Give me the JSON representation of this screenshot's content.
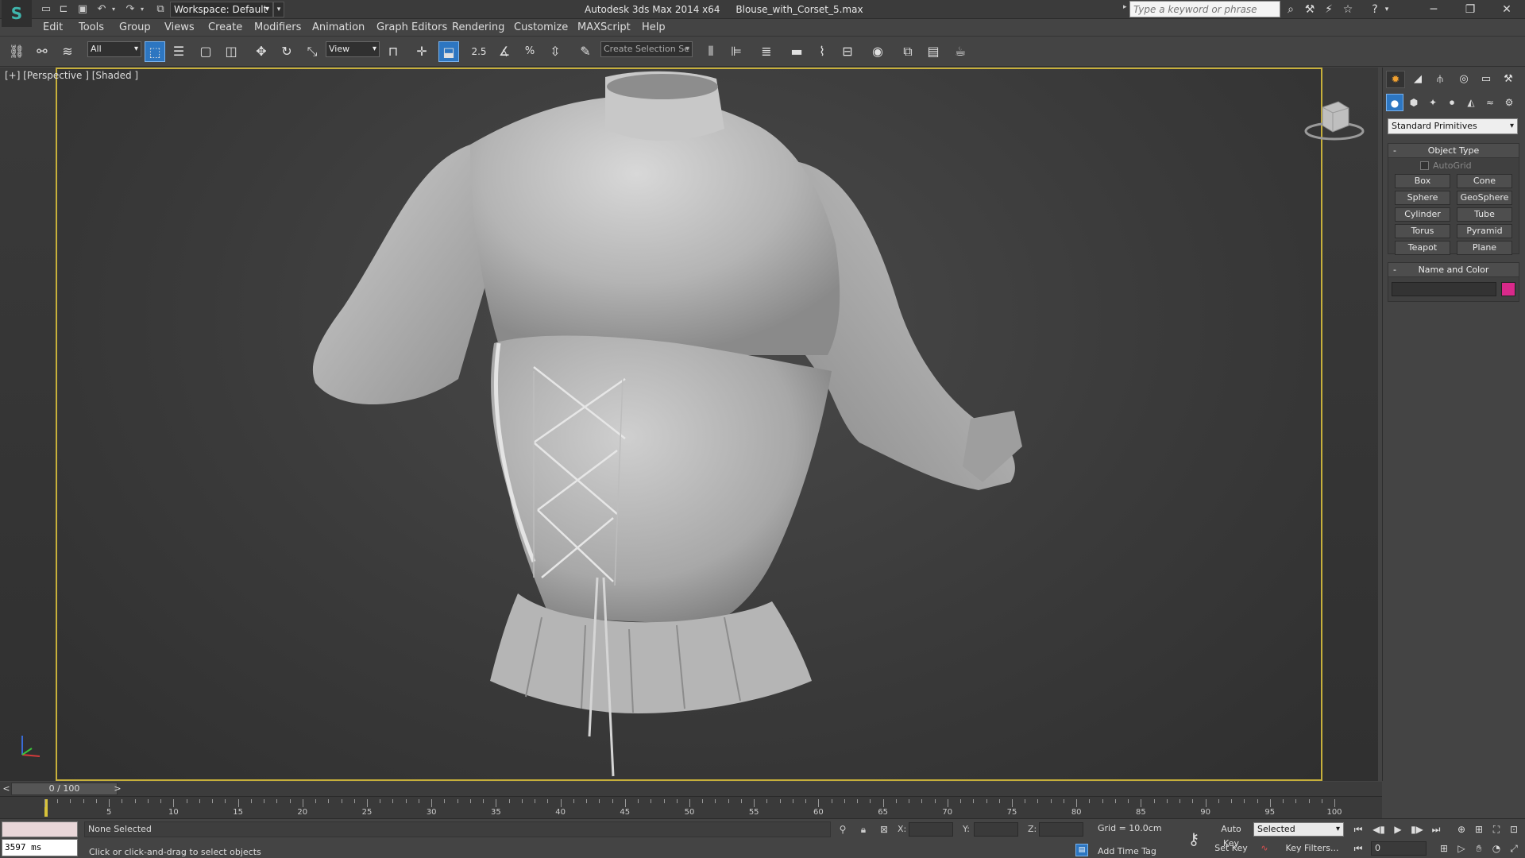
{
  "window": {
    "app_title": "Autodesk 3ds Max  2014 x64",
    "file_name": "Blouse_with_Corset_5.max",
    "workspace": "Workspace: Default",
    "search_placeholder": "Type a keyword or phrase"
  },
  "menu": [
    "Edit",
    "Tools",
    "Group",
    "Views",
    "Create",
    "Modifiers",
    "Animation",
    "Graph Editors",
    "Rendering",
    "Customize",
    "MAXScript",
    "Help"
  ],
  "toolbar": {
    "selection_filter": "All",
    "ref_coord": "View",
    "snap_angle": "2.5",
    "named_selection": "Create Selection Se"
  },
  "viewport": {
    "label": "[+] [Perspective ] [Shaded ]"
  },
  "command_panel": {
    "category": "Standard Primitives",
    "object_type_title": "Object Type",
    "autogrid": "AutoGrid",
    "primitives": [
      "Box",
      "Cone",
      "Sphere",
      "GeoSphere",
      "Cylinder",
      "Tube",
      "Torus",
      "Pyramid",
      "Teapot",
      "Plane"
    ],
    "name_color_title": "Name and Color",
    "object_color": "#d9298a"
  },
  "timeline": {
    "position": "0 / 100",
    "ticks": [
      "5",
      "10",
      "15",
      "20",
      "25",
      "30",
      "35",
      "40",
      "45",
      "50",
      "55",
      "60",
      "65",
      "70",
      "75",
      "80",
      "85",
      "90",
      "95",
      "100"
    ]
  },
  "status": {
    "maxscript_output": "3597 ms",
    "selection": "None Selected",
    "prompt": "Click or click-and-drag to select objects",
    "x_label": "X:",
    "y_label": "Y:",
    "z_label": "Z:",
    "grid": "Grid = 10.0cm",
    "add_time_tag": "Add Time Tag",
    "auto_key": "Auto Key",
    "set_key": "Set Key",
    "key_mode": "Selected",
    "key_filters": "Key Filters...",
    "current_frame": "0"
  },
  "colors": {
    "accent": "#2d76c1",
    "viewport_border": "#c7b03b",
    "time_marker": "#d7c23a"
  }
}
